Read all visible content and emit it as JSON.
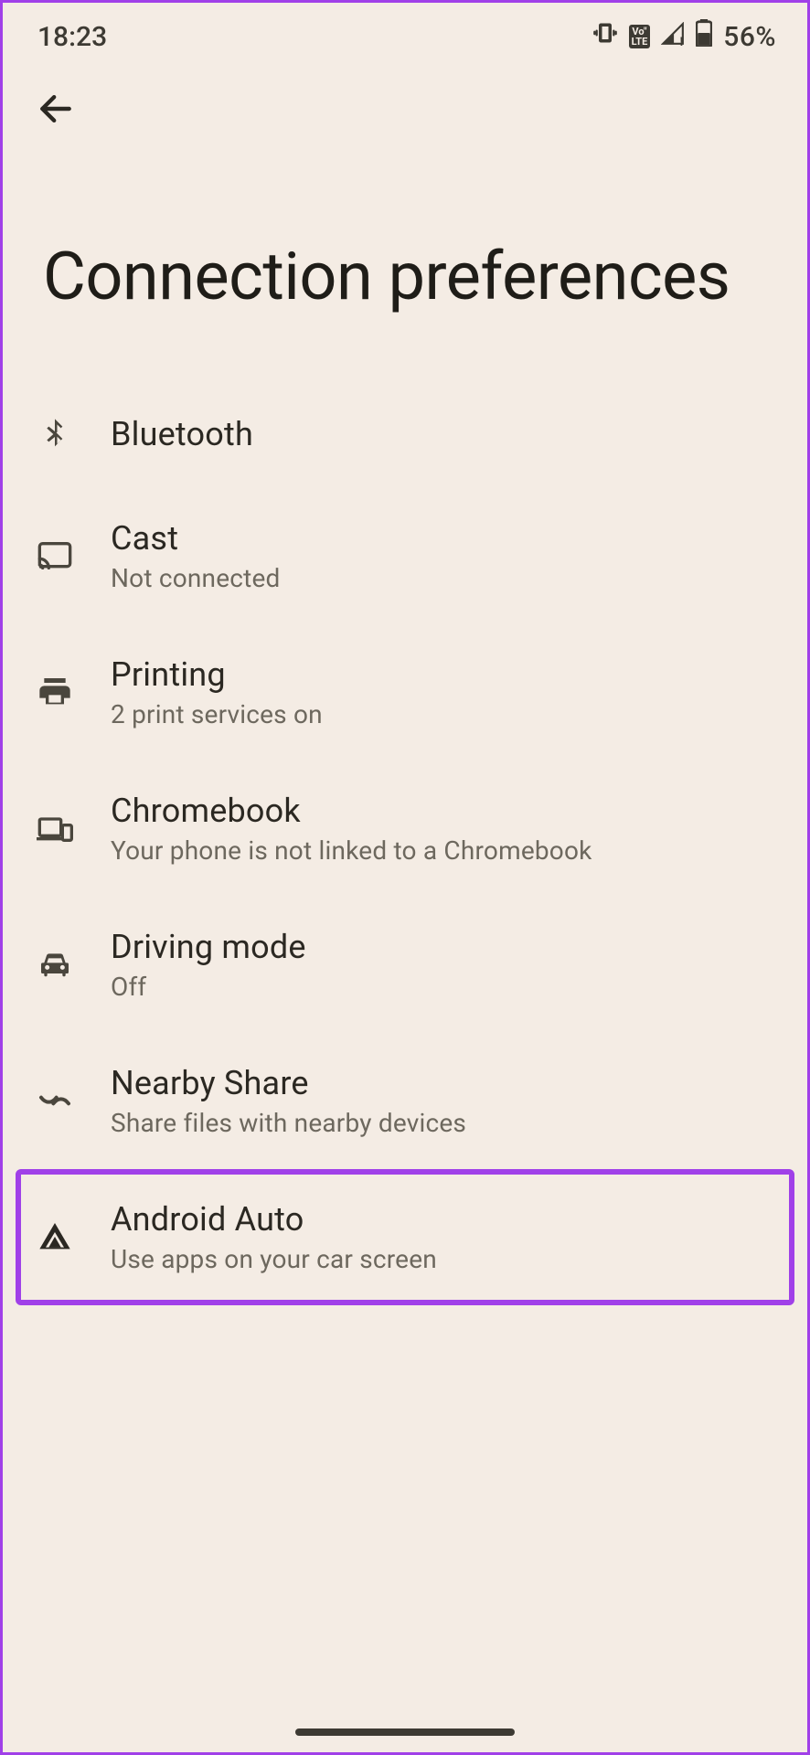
{
  "status": {
    "time": "18:23",
    "battery_pct": "56%"
  },
  "page": {
    "title": "Connection preferences"
  },
  "items": [
    {
      "key": "bluetooth",
      "title": "Bluetooth",
      "sub": ""
    },
    {
      "key": "cast",
      "title": "Cast",
      "sub": "Not connected"
    },
    {
      "key": "printing",
      "title": "Printing",
      "sub": "2 print services on"
    },
    {
      "key": "chromebook",
      "title": "Chromebook",
      "sub": "Your phone is not linked to a Chromebook"
    },
    {
      "key": "driving",
      "title": "Driving mode",
      "sub": "Off"
    },
    {
      "key": "nearby",
      "title": "Nearby Share",
      "sub": "Share files with nearby devices"
    },
    {
      "key": "android_auto",
      "title": "Android Auto",
      "sub": "Use apps on your car screen"
    }
  ],
  "highlight_key": "android_auto"
}
